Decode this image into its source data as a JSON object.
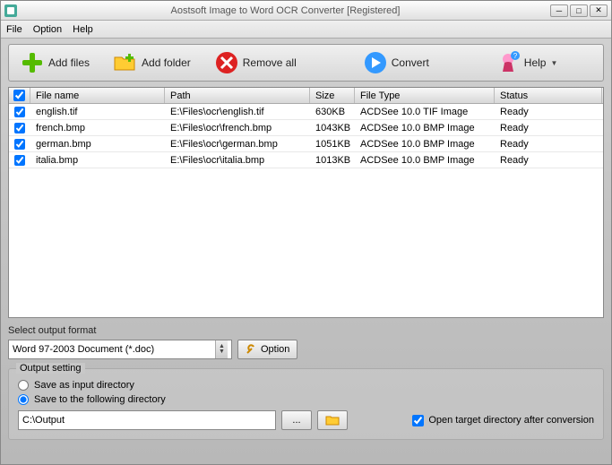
{
  "title": "Aostsoft Image to Word OCR Converter [Registered]",
  "menu": {
    "file": "File",
    "option": "Option",
    "help": "Help"
  },
  "toolbar": {
    "add_files": "Add files",
    "add_folder": "Add folder",
    "remove_all": "Remove all",
    "convert": "Convert",
    "help": "Help"
  },
  "columns": {
    "name": "File name",
    "path": "Path",
    "size": "Size",
    "type": "File Type",
    "status": "Status"
  },
  "rows": [
    {
      "checked": true,
      "name": "english.tif",
      "path": "E:\\Files\\ocr\\english.tif",
      "size": "630KB",
      "type": "ACDSee 10.0 TIF Image",
      "status": "Ready"
    },
    {
      "checked": true,
      "name": "french.bmp",
      "path": "E:\\Files\\ocr\\french.bmp",
      "size": "1043KB",
      "type": "ACDSee 10.0 BMP Image",
      "status": "Ready"
    },
    {
      "checked": true,
      "name": "german.bmp",
      "path": "E:\\Files\\ocr\\german.bmp",
      "size": "1051KB",
      "type": "ACDSee 10.0 BMP Image",
      "status": "Ready"
    },
    {
      "checked": true,
      "name": "italia.bmp",
      "path": "E:\\Files\\ocr\\italia.bmp",
      "size": "1013KB",
      "type": "ACDSee 10.0 BMP Image",
      "status": "Ready"
    }
  ],
  "format": {
    "label": "Select output format",
    "value": "Word 97-2003 Document (*.doc)",
    "option_btn": "Option"
  },
  "output": {
    "legend": "Output setting",
    "save_input": "Save as input directory",
    "save_following": "Save to the following directory",
    "path": "C:\\Output",
    "open_target": "Open target directory after conversion",
    "browse": "...",
    "selected": "following"
  }
}
